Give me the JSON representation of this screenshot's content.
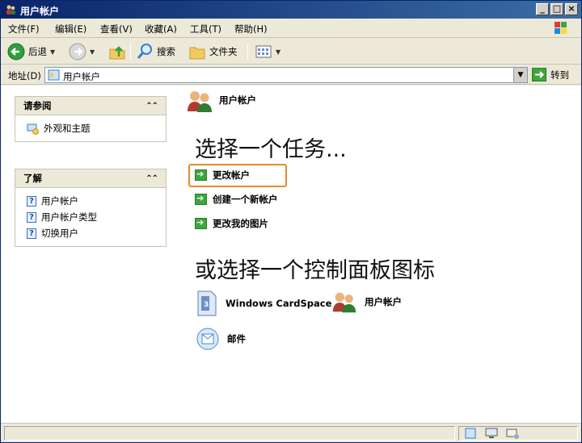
{
  "window": {
    "title": "用户帐户",
    "controls": [
      "_",
      "□",
      "×"
    ]
  },
  "menu": [
    {
      "label": "文件(F)"
    },
    {
      "label": "编辑(E)"
    },
    {
      "label": "查看(V)"
    },
    {
      "label": "收藏(A)"
    },
    {
      "label": "工具(T)"
    },
    {
      "label": "帮助(H)"
    }
  ],
  "toolbar": {
    "back_label": "后退",
    "search_label": "搜索",
    "folders_label": "文件夹"
  },
  "address": {
    "label": "地址(D)",
    "value": "用户帐户",
    "go_label": "转到"
  },
  "sidebar": {
    "see_also": {
      "title": "请参阅",
      "items": [
        {
          "label": "外观和主题",
          "icon": "appearance-icon"
        }
      ]
    },
    "learn": {
      "title": "了解",
      "items": [
        {
          "label": "用户帐户",
          "icon": "help-icon"
        },
        {
          "label": "用户帐户类型",
          "icon": "help-icon"
        },
        {
          "label": "切换用户",
          "icon": "help-icon"
        }
      ]
    }
  },
  "main": {
    "title": "用户帐户",
    "task_heading": "选择一个任务...",
    "tasks": [
      {
        "label": "更改帐户",
        "highlighted": true
      },
      {
        "label": "创建一个新帐户"
      },
      {
        "label": "更改我的图片"
      }
    ],
    "icon_heading": "或选择一个控制面板图标",
    "icons": [
      {
        "label": "Windows CardSpace",
        "icon": "cardspace-icon"
      },
      {
        "label": "用户帐户",
        "icon": "users-icon"
      },
      {
        "label": "邮件",
        "icon": "mail-icon"
      }
    ]
  },
  "colors": {
    "titlebar": "#0a246a",
    "highlight": "#e98a2d",
    "task_arrow": "#3ca83c"
  }
}
